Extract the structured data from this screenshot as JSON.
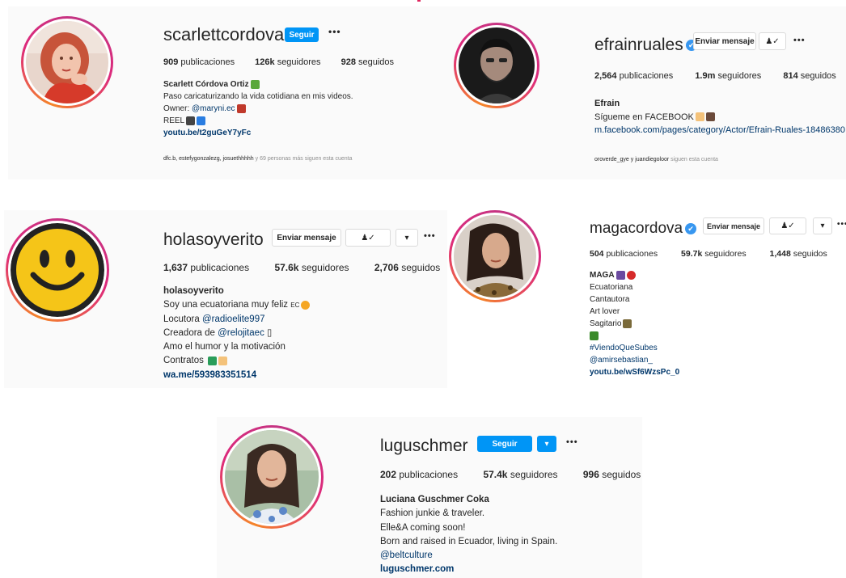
{
  "profiles": {
    "scarlett": {
      "username": "scarlettcordova9",
      "follow_label": "Seguir",
      "more": "•••",
      "posts_count": "909",
      "posts_label": "publicaciones",
      "followers_count": "126k",
      "followers_label": "seguidores",
      "following_count": "928",
      "following_label": "seguidos",
      "name": "Scarlett Córdova Ortiz",
      "bio": [
        "Paso caricaturizando la vida cotidiana en mis videos."
      ],
      "owner_label": "Owner: ",
      "owner_mention": "@maryni.ec",
      "reel": "REEL",
      "link": "youtu.be/t2guGeY7yFc",
      "followed_users": "dfc.b, estefygonzalezg, josuethhhhh",
      "followed_text": " y 69 personas más siguen esta cuenta"
    },
    "efrain": {
      "username": "efrainruales",
      "verified_icon": "✔",
      "message_label": "Enviar mensaje",
      "more": "•••",
      "posts_count": "2,564",
      "posts_label": "publicaciones",
      "followers_count": "1.9m",
      "followers_label": "seguidores",
      "following_count": "814",
      "following_label": "seguidos",
      "name": "Efrain",
      "bio": [
        "Sígueme en FACEBOOK"
      ],
      "link": "m.facebook.com/pages/category/Actor/Efrain-Ruales-18486380",
      "followed_users": "oroverde_gye y juandiegoloor",
      "followed_text": " siguen esta cuenta"
    },
    "verito": {
      "username": "holasoyverito",
      "message_label": "Enviar mensaje",
      "dropdown": "▾",
      "more": "•••",
      "posts_count": "1,637",
      "posts_label": "publicaciones",
      "followers_count": "57.6k",
      "followers_label": "seguidores",
      "following_count": "2,706",
      "following_label": "seguidos",
      "name": "holasoyverito",
      "bio_1": "Soy una ecuatoriana muy feliz ",
      "flag_text": "EC",
      "locutora_label": "Locutora ",
      "locutora_mention": "@radioelite997",
      "creadora_label": "Creadora de ",
      "creadora_mention": "@relojitaec",
      "creadora_box": "▯",
      "bio_2": "Amo el humor y la motivación",
      "contratos": "Contratos ",
      "link": "wa.me/593983351514"
    },
    "maga": {
      "username": "magacordova",
      "verified_icon": "✔",
      "message_label": "Enviar mensaje",
      "dropdown": "▾",
      "more": "•••",
      "posts_count": "504",
      "posts_label": "publicaciones",
      "followers_count": "59.7k",
      "followers_label": "seguidores",
      "following_count": "1,448",
      "following_label": "seguidos",
      "name": "MAGA",
      "bio": [
        "Ecuatoriana",
        "Cantautora",
        "Art lover",
        "Sagitario"
      ],
      "hashtag": "#ViendoQueSubes",
      "mention": "@amirsebastian_",
      "link": "youtu.be/wSf6WzsPc_0"
    },
    "lugu": {
      "username": "luguschmer",
      "follow_label": "Seguir",
      "dropdown": "▾",
      "more": "•••",
      "posts_count": "202",
      "posts_label": "publicaciones",
      "followers_count": "57.4k",
      "followers_label": "seguidores",
      "following_count": "996",
      "following_label": "seguidos",
      "name": "Luciana Guschmer Coka",
      "bio": [
        "Fashion junkie & traveler.",
        "Elle&A coming soon!",
        "Born and raised in Ecuador, living in Spain."
      ],
      "mention": "@beltculture",
      "link": "luguschmer.com"
    }
  },
  "colors": {
    "accent": "#0095f6",
    "link": "#00376b",
    "verified": "#3897f0",
    "panel": "#fafafa"
  },
  "icons": {
    "follow_status": "person-check-icon"
  }
}
